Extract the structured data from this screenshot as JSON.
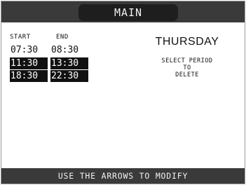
{
  "header": {
    "title": "MAIN"
  },
  "schedule": {
    "start_label": "START",
    "end_label": "END",
    "periods": [
      {
        "start": "07:30",
        "end": "08:30",
        "selected": false
      },
      {
        "start": "11:30",
        "end": "13:30",
        "selected": true
      },
      {
        "start": "18:30",
        "end": "22:30",
        "selected": true
      }
    ]
  },
  "day": "THURSDAY",
  "instruction": {
    "line1": "SELECT PERIOD",
    "line2": "TO",
    "line3": "DELETE"
  },
  "footer": {
    "text": "USE THE ARROWS TO MODIFY"
  },
  "colors": {
    "bar": "#3a3a3a",
    "title_tab": "#1e1e1e",
    "selected_bg": "#111111",
    "selected_fg": "#ffffff"
  }
}
